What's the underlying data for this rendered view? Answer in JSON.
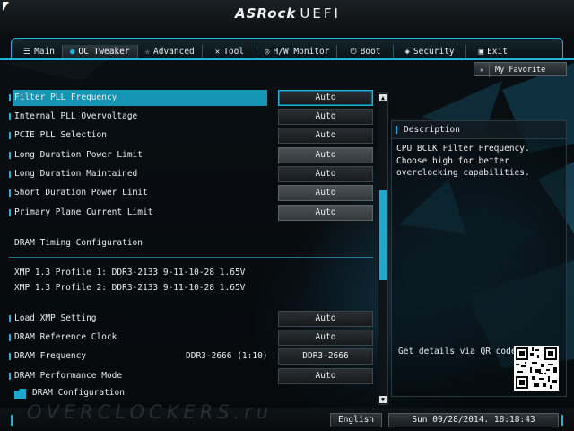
{
  "header": {
    "logo_brand": "ASRock",
    "logo_product": "UEFI"
  },
  "tabs": [
    {
      "icon": "list-icon",
      "glyph": "☰",
      "label": "Main"
    },
    {
      "icon": "flame-icon",
      "glyph": "●",
      "label": "OC Tweaker",
      "active": true
    },
    {
      "icon": "star-icon",
      "glyph": "☆",
      "label": "Advanced"
    },
    {
      "icon": "tool-icon",
      "glyph": "✕",
      "label": "Tool"
    },
    {
      "icon": "monitor-icon",
      "glyph": "◎",
      "label": "H/W Monitor"
    },
    {
      "icon": "power-icon",
      "glyph": "⏻",
      "label": "Boot"
    },
    {
      "icon": "shield-icon",
      "glyph": "◈",
      "label": "Security"
    },
    {
      "icon": "exit-icon",
      "glyph": "▣",
      "label": "Exit"
    }
  ],
  "favorite": {
    "icon": "star-icon",
    "glyph": "★",
    "label": "My Favorite"
  },
  "settings": {
    "filter_pll": {
      "label": "Filter PLL Frequency",
      "value": "Auto"
    },
    "internal_pll": {
      "label": "Internal PLL Overvoltage",
      "value": "Auto"
    },
    "pcie_pll": {
      "label": "PCIE PLL Selection",
      "value": "Auto"
    },
    "long_dur_power": {
      "label": "Long Duration Power Limit",
      "value": "Auto"
    },
    "long_dur_maint": {
      "label": "Long Duration Maintained",
      "value": "Auto"
    },
    "short_dur_power": {
      "label": "Short Duration Power Limit",
      "value": "Auto"
    },
    "primary_plane": {
      "label": "Primary Plane Current Limit",
      "value": "Auto"
    },
    "dram_timing_header": "DRAM Timing Configuration",
    "xmp1": "XMP 1.3 Profile 1: DDR3-2133 9-11-10-28 1.65V",
    "xmp2": "XMP 1.3 Profile 2: DDR3-2133 9-11-10-28 1.65V",
    "load_xmp": {
      "label": "Load XMP Setting",
      "value": "Auto"
    },
    "dram_ref_clock": {
      "label": "DRAM Reference Clock",
      "value": "Auto"
    },
    "dram_freq": {
      "label": "DRAM Frequency",
      "info": "DDR3-2666 (1:10)",
      "value": "DDR3-2666"
    },
    "dram_perf": {
      "label": "DRAM Performance Mode",
      "value": "Auto"
    },
    "dram_config": {
      "label": "DRAM Configuration"
    }
  },
  "description": {
    "title": "Description",
    "text": "CPU BCLK Filter Frequency. Choose high for better overclocking capabilities.",
    "qr_text": "Get details via QR code"
  },
  "footer": {
    "watermark": "OVERCLOCKERS.ru",
    "language": "English",
    "datetime": "Sun 09/28/2014. 18:18:43"
  },
  "colors": {
    "accent": "#1fb3d8",
    "selection": "#1594b4"
  }
}
